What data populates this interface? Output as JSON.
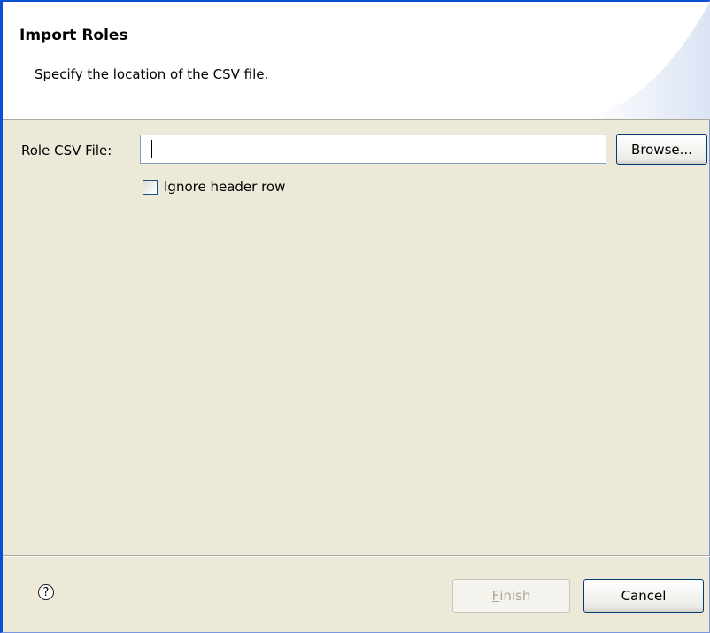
{
  "header": {
    "title": "Import Roles",
    "subtitle": "Specify the location of the CSV file."
  },
  "form": {
    "file_label": "Role CSV File:",
    "file_value": "",
    "browse_label": "Browse...",
    "ignore_header_label": "Ignore header row",
    "ignore_header_checked": false
  },
  "footer": {
    "help_icon": "help-icon",
    "finish_label": "Finish",
    "finish_mnemonic": "F",
    "finish_rest": "inish",
    "cancel_label": "Cancel"
  },
  "colors": {
    "window_border": "#0a4fd6",
    "dialog_bg": "#ece9d8",
    "header_bg": "#ffffff"
  }
}
